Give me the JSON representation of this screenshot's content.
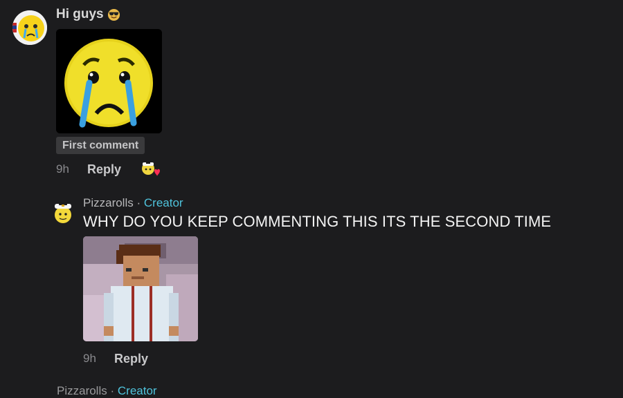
{
  "comment": {
    "text": "Hi guys",
    "emoji_icon": "smiling-face-with-sunglasses-icon",
    "sticker_icon": "crying-face-sticker",
    "badge": "First comment",
    "time": "9h",
    "reply_label": "Reply",
    "liked_by_creator_icon": "creator-heart-icon"
  },
  "reply": {
    "author": "Pizzarolls",
    "separator": "·",
    "creator_label": "Creator",
    "text": "WHY DO YOU KEEP COMMENTING THIS ITS THE SECOND TIME",
    "image_icon": "minecraft-character-image",
    "time": "9h",
    "reply_label": "Reply"
  },
  "next_reply": {
    "author": "Pizzarolls",
    "separator": "·",
    "creator_label": "Creator"
  },
  "colors": {
    "background": "#1c1c1e",
    "creator_accent": "#4fc3dc",
    "badge_bg": "#3a3a3c"
  }
}
